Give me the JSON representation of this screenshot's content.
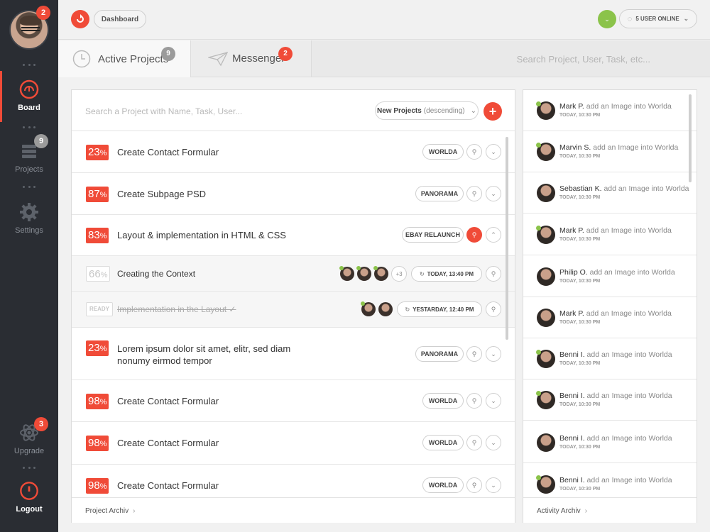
{
  "sidebar": {
    "avatar_badge": "2",
    "items": [
      {
        "label": "Board",
        "icon": "gauge-icon"
      },
      {
        "label": "Projects",
        "icon": "stack-icon",
        "badge": "9"
      },
      {
        "label": "Settings",
        "icon": "gear-icon"
      },
      {
        "label": "Upgrade",
        "icon": "atom-icon",
        "badge": "3"
      },
      {
        "label": "Logout",
        "icon": "power-icon"
      }
    ]
  },
  "topbar": {
    "breadcrumb": "Dashboard",
    "users_online": "5 USER ONLINE"
  },
  "tabs": {
    "active_projects": {
      "label": "Active Projects",
      "badge": "9"
    },
    "messenger": {
      "label": "Messenger",
      "badge": "2"
    },
    "search_placeholder": "Search Project, User, Task, etc..."
  },
  "projects": {
    "search_placeholder": "Search a Project with Name, Task, User...",
    "sort_label": "New Projects",
    "sort_hint": "(descending)",
    "footer": "Project Archiv",
    "rows": [
      {
        "pct": "23",
        "title": "Create Contact Formular",
        "tag": "WORLDA"
      },
      {
        "pct": "87",
        "title": "Create Subpage PSD",
        "tag": "PANORAMA"
      },
      {
        "pct": "83",
        "title": "Layout & implementation in HTML & CSS",
        "tag": "EBAY RELAUNCH"
      },
      {
        "pct": "23",
        "title": "Lorem ipsum dolor sit amet, elitr, sed diam",
        "title2": "nonumy eirmod tempor",
        "tag": "PANORAMA"
      },
      {
        "pct": "98",
        "title": "Create Contact Formular",
        "tag": "WORLDA"
      },
      {
        "pct": "98",
        "title": "Create Contact Formular",
        "tag": "WORLDA"
      },
      {
        "pct": "98",
        "title": "Create Contact Formular",
        "tag": "WORLDA"
      }
    ],
    "subtasks": [
      {
        "pct": "66",
        "title": "Creating the Context",
        "extra": "+3",
        "date": "TODAY, 13:40 PM"
      },
      {
        "status": "READY",
        "title": "Implementation in the Layout ✓",
        "date": "YESTARDAY, 12:40 PM"
      }
    ]
  },
  "activity": {
    "footer": "Activity Archiv",
    "items": [
      {
        "name": "Mark P.",
        "text": "add an Image into Worlda",
        "time": "TODAY, 10:30 PM"
      },
      {
        "name": "Marvin S.",
        "text": "add an Image into Worlda",
        "time": "TODAY, 10:30 PM"
      },
      {
        "name": "Sebastian K.",
        "text": "add an Image into Worlda",
        "time": "TODAY, 10:30 PM"
      },
      {
        "name": "Mark P.",
        "text": "add an Image into Worlda",
        "time": "TODAY, 10:30 PM"
      },
      {
        "name": "Philip O.",
        "text": "add an Image into Worlda",
        "time": "TODAY, 10:30 PM"
      },
      {
        "name": "Mark P.",
        "text": "add an Image into Worlda",
        "time": "TODAY, 10:30 PM"
      },
      {
        "name": "Benni I.",
        "text": "add an Image into Worlda",
        "time": "TODAY, 10:30 PM"
      },
      {
        "name": "Benni I.",
        "text": "add an Image into Worlda",
        "time": "TODAY, 10:30 PM"
      },
      {
        "name": "Benni I.",
        "text": "add an Image into Worlda",
        "time": "TODAY, 10:30 PM"
      },
      {
        "name": "Benni I.",
        "text": "add an Image into Worlda",
        "time": "TODAY, 10:30 PM"
      }
    ]
  },
  "colors": {
    "accent": "#f04b38",
    "sidebar": "#2a2d33",
    "online": "#8bc34a"
  }
}
